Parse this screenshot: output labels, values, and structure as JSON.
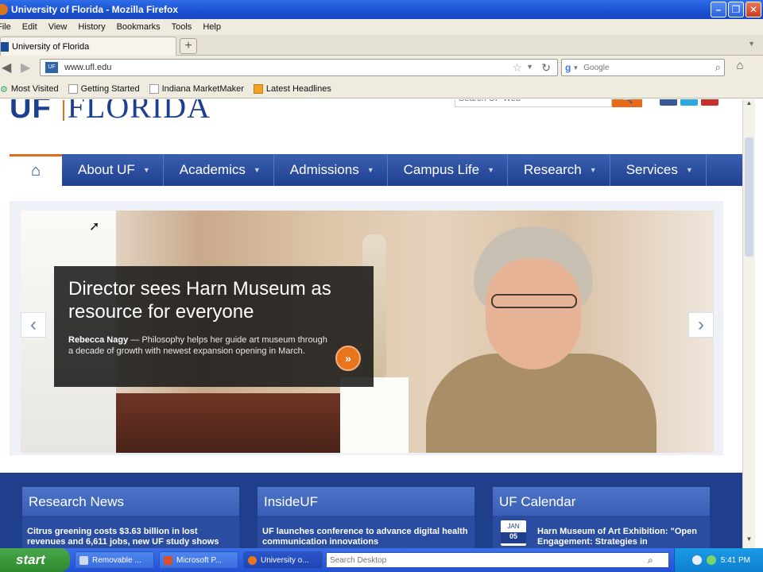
{
  "window": {
    "title": "University of Florida - Mozilla Firefox"
  },
  "menu": [
    "File",
    "Edit",
    "View",
    "History",
    "Bookmarks",
    "Tools",
    "Help"
  ],
  "tab": {
    "label": "University of Florida"
  },
  "nav": {
    "url": "www.ufl.edu",
    "search_placeholder": "Google"
  },
  "bookmarks": [
    "Most Visited",
    "Getting Started",
    "Indiana MarketMaker",
    "Latest Headlines"
  ],
  "site": {
    "logo_uf": "UF",
    "logo_text": "FLORIDA",
    "search_placeholder": "Search UF Web"
  },
  "mainnav": [
    "About UF",
    "Academics",
    "Admissions",
    "Campus Life",
    "Research",
    "Services"
  ],
  "hero": {
    "title": "Director sees Harn Museum as resource for everyone",
    "name": "Rebecca Nagy",
    "text": " — Philosophy helps her guide art museum through a decade of growth with newest expansion opening in March."
  },
  "panels": [
    {
      "title": "Research News",
      "text": "Citrus greening costs $3.63 billion in lost revenues and 6,611 jobs, new UF study shows"
    },
    {
      "title": "InsideUF",
      "text": "UF launches conference to advance digital health communication innovations"
    },
    {
      "title": "UF Calendar",
      "text": "Harn Museum of Art Exhibition: \"Open Engagement: Strategies in",
      "month": "JAN",
      "day": "05"
    }
  ],
  "taskbar": {
    "start": "start",
    "tasks": [
      "Removable ...",
      "Microsoft P...",
      "University o..."
    ],
    "search_placeholder": "Search Desktop",
    "time": "5:41 PM"
  },
  "colors": {
    "uf_blue": "#1c3f8f",
    "uf_orange": "#e36c20"
  }
}
